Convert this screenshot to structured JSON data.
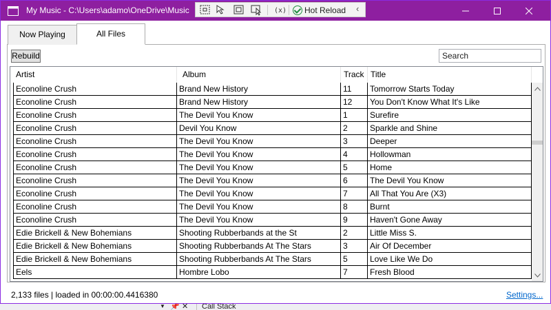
{
  "window": {
    "title": "My Music - C:\\Users\\adamo\\OneDrive\\Music",
    "accent": "#8e1fa0"
  },
  "debug_toolbar": {
    "hot_reload_label": "Hot Reload",
    "icons": [
      "select-visual-tree-icon",
      "select-element-icon",
      "display-layout-adorners-icon",
      "track-focused-element-icon",
      "binding-failures-icon",
      "hot-reload-status-icon",
      "collapse-chevron-icon"
    ]
  },
  "tabs": [
    {
      "label": "Now Playing",
      "selected": false
    },
    {
      "label": "All Files",
      "selected": true
    }
  ],
  "toolbar": {
    "rebuild_label": "Rebuild",
    "search_value": "Search"
  },
  "grid": {
    "columns": [
      "Artist",
      "Album",
      "Track",
      "Title"
    ],
    "rows": [
      {
        "artist": "Econoline Crush",
        "album": "Brand New History",
        "track": "11",
        "title": "Tomorrow Starts Today"
      },
      {
        "artist": "Econoline Crush",
        "album": "Brand New History",
        "track": "12",
        "title": "You Don't Know What It's Like"
      },
      {
        "artist": "Econoline Crush",
        "album": "The Devil You Know",
        "track": "1",
        "title": "Surefire"
      },
      {
        "artist": "Econoline Crush",
        "album": "Devil You Know",
        "track": "2",
        "title": "Sparkle and Shine"
      },
      {
        "artist": "Econoline Crush",
        "album": "The Devil You Know",
        "track": "3",
        "title": "Deeper"
      },
      {
        "artist": "Econoline Crush",
        "album": "The Devil You Know",
        "track": "4",
        "title": "Hollowman"
      },
      {
        "artist": "Econoline Crush",
        "album": "The Devil You Know",
        "track": "5",
        "title": "Home"
      },
      {
        "artist": "Econoline Crush",
        "album": "The Devil You Know",
        "track": "6",
        "title": "The Devil You Know"
      },
      {
        "artist": "Econoline Crush",
        "album": "The Devil You Know",
        "track": "7",
        "title": "All That You Are (X3)"
      },
      {
        "artist": "Econoline Crush",
        "album": "The Devil You Know",
        "track": "8",
        "title": "Burnt"
      },
      {
        "artist": "Econoline Crush",
        "album": "The Devil You Know",
        "track": "9",
        "title": "Haven't Gone Away"
      },
      {
        "artist": "Edie Brickell & New Bohemians",
        "album": "Shooting Rubberbands at the St",
        "track": "2",
        "title": "Little Miss S."
      },
      {
        "artist": "Edie Brickell & New Bohemians",
        "album": "Shooting Rubberbands At The Stars",
        "track": "3",
        "title": "Air Of December"
      },
      {
        "artist": "Edie Brickell & New Bohemians",
        "album": "Shooting Rubberbands At The Stars",
        "track": "5",
        "title": "Love Like We Do"
      },
      {
        "artist": "Eels",
        "album": "Hombre Lobo",
        "track": "7",
        "title": "Fresh Blood"
      }
    ]
  },
  "status": {
    "text": "2,133 files | loaded in 00:00:00.4416380",
    "settings_label": "Settings..."
  },
  "background": {
    "panel_label": "Call Stack"
  }
}
